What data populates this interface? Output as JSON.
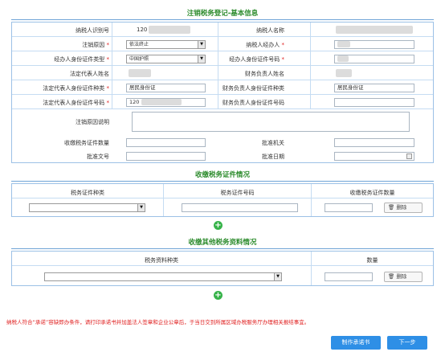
{
  "section1": {
    "title": "注销税务登记-基本信息",
    "rows": [
      {
        "left_label": "纳税人识别号",
        "left_value": "120",
        "right_label": "纳税人名称"
      },
      {
        "left_label": "注销原因",
        "left_select": "依法终止",
        "right_label": "纳税人经办人"
      },
      {
        "left_label": "经办人身份证件类型",
        "left_select": "中国护照",
        "right_label": "经办人身份证件号码"
      },
      {
        "left_label": "法定代表人姓名",
        "right_label": "财务负责人姓名"
      },
      {
        "left_label": "法定代表人身份证件种类",
        "left_value": "居民身份证",
        "right_label": "财务负责人身份证件种类",
        "right_value": "居民身份证"
      },
      {
        "left_label": "法定代表人身份证件号码",
        "left_value": "120",
        "right_label": "财务负责人身份证件号码"
      }
    ],
    "reason_label": "注销原因说明",
    "bottom_rows": [
      {
        "left_label": "收缴税务证件数量",
        "right_label": "批准机关"
      },
      {
        "left_label": "批准文号",
        "right_label": "批准日期"
      }
    ],
    "required_mark": "*"
  },
  "section2": {
    "title": "收缴税务证件情况",
    "headers": [
      "税务证件种类",
      "税务证件号码",
      "收缴税务证件数量"
    ],
    "delete_label": "删除",
    "add_icon": "plus-circle-icon"
  },
  "section3": {
    "title": "收缴其他税务资料情况",
    "headers": [
      "税务资料种类",
      "数量"
    ],
    "delete_label": "删除",
    "add_icon": "plus-circle-icon"
  },
  "notice": "纳税人符合“承诺”容缺即办条件，请打印承诺书并加盖法人签章和企业公章后，于当日交到所属区域办税服务厅办理相关报结事宜。",
  "buttons": {
    "print": "制作承诺书",
    "next": "下一步"
  },
  "colors": {
    "title_green": "#2a8a2a",
    "border_blue": "#9cc1e6",
    "button_blue": "#2e8fe6",
    "notice_red": "#e02020",
    "add_green": "#37b34a"
  }
}
